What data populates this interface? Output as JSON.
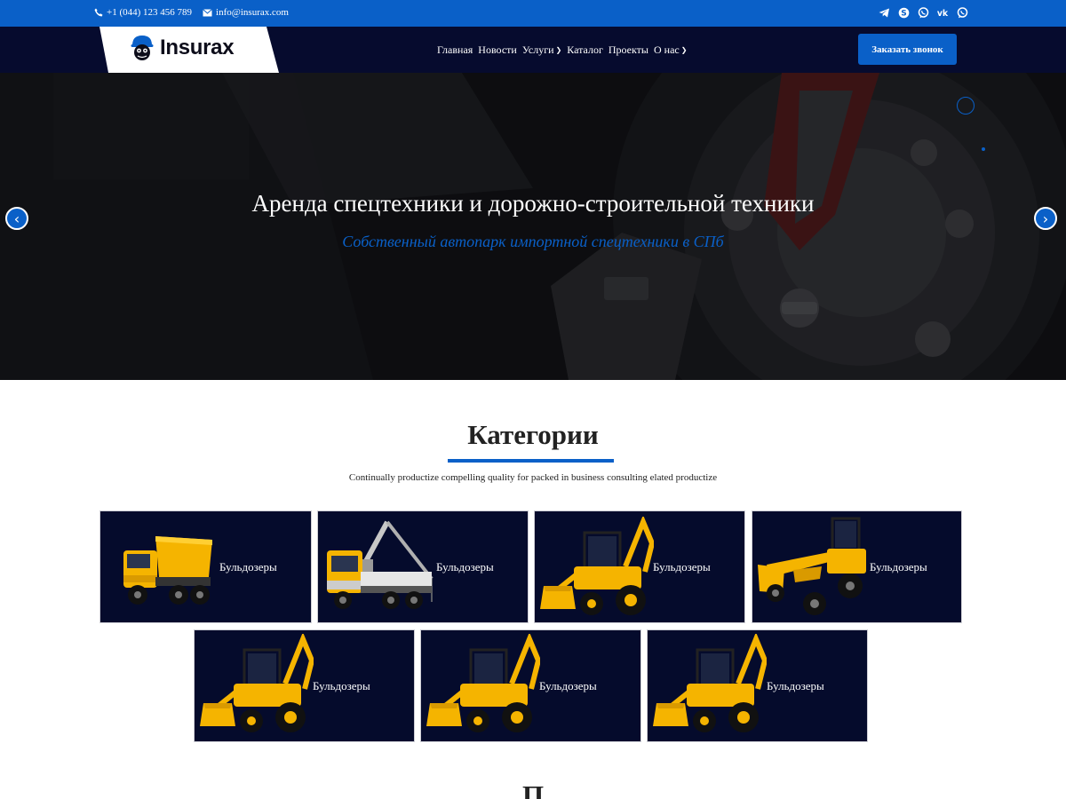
{
  "topbar": {
    "phone": "+1 (044) 123 456 789",
    "email": "info@insurax.com",
    "socials": [
      "telegram-icon",
      "skype-icon",
      "viber-icon",
      "vk-icon",
      "whatsapp-icon"
    ]
  },
  "brand": {
    "name": "Insurax"
  },
  "nav": {
    "items": [
      {
        "label": "Главная",
        "has_dropdown": false
      },
      {
        "label": "Новости",
        "has_dropdown": false
      },
      {
        "label": "Услуги",
        "has_dropdown": true
      },
      {
        "label": "Каталог",
        "has_dropdown": false
      },
      {
        "label": "Проекты",
        "has_dropdown": false
      },
      {
        "label": "О нас",
        "has_dropdown": true
      }
    ],
    "cta": "Заказать звонок"
  },
  "hero": {
    "title": "Аренда спецтехники и дорожно-строительной техники",
    "subtitle": "Собственный автопарк импортной спецтехники в СПб"
  },
  "categories": {
    "title": "Категории",
    "subtitle": "Continually productize compelling quality for packed in business consulting elated productize",
    "cards": [
      {
        "label": "Бульдозеры",
        "image": "dump-truck"
      },
      {
        "label": "Бульдозеры",
        "image": "crane-truck"
      },
      {
        "label": "Бульдозеры",
        "image": "backhoe-loader"
      },
      {
        "label": "Бульдозеры",
        "image": "motor-grader"
      },
      {
        "label": "Бульдозеры",
        "image": "backhoe-loader"
      },
      {
        "label": "Бульдозеры",
        "image": "backhoe-loader"
      },
      {
        "label": "Бульдозеры",
        "image": "backhoe-loader"
      }
    ]
  },
  "next_section": {
    "title": "П"
  },
  "colors": {
    "accent": "#0a60c8",
    "navy": "#060b2e",
    "card_bg": "#050b2c",
    "machine_yellow": "#f5b400"
  }
}
